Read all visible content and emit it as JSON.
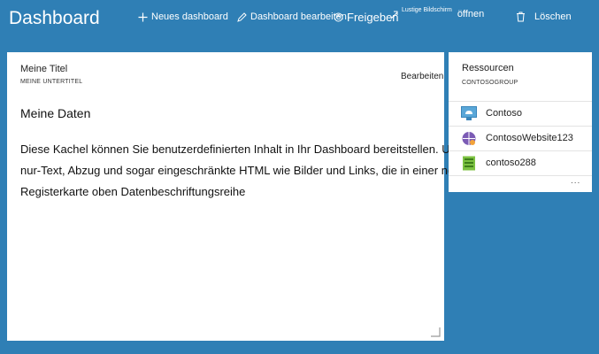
{
  "header": {
    "title": "Dashboard",
    "commands": {
      "new_dashboard": "Neues dashboard",
      "edit_dashboard": "Dashboard bearbeiten",
      "share": "Freigeben",
      "fun_screen_small": "Lustige Bildschirm",
      "fun_screen_open": "öffnen",
      "delete": "Löschen"
    }
  },
  "tile": {
    "title": "Meine Titel",
    "subtitle": "MEINE UNTERTITEL",
    "edit_label": "Bearbeiten",
    "heading": "Meine Daten",
    "body_lines": [
      "Diese Kachel können Sie benutzerdefinierten Inhalt in Ihr Dashboard bereitstellen. Unterstützt",
      "nur-Text, Abzug und sogar eingeschränkte HTML wie Bilder und Links, die in einer neuen",
      "Registerkarte oben Datenbeschriftungsreihe"
    ]
  },
  "resources": {
    "title": "Ressourcen",
    "subtitle": "CONTOSOGROUP",
    "items": [
      {
        "label": "Contoso",
        "icon": "cloud-service-icon"
      },
      {
        "label": "ContosoWebsite123",
        "icon": "website-icon"
      },
      {
        "label": "contoso288",
        "icon": "storage-icon"
      }
    ],
    "more": "..."
  },
  "colors": {
    "background": "#2f7fb5",
    "tile": "#ffffff"
  }
}
